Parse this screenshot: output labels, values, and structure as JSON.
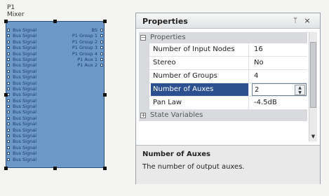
{
  "node": {
    "caption": "P1",
    "sub_caption": "Mixer",
    "inputs": [
      "Bus Signal",
      "Bus Signal",
      "Bus Signal",
      "Bus Signal",
      "Bus Signal",
      "Bus Signal",
      "Bus Signal",
      "Bus Signal",
      "Bus Signal",
      "Bus Signal",
      "Bus Signal",
      "Bus Signal",
      "Bus Signal",
      "Bus Signal",
      "Bus Signal",
      "Bus Signal",
      "Bus Signal",
      "Bus Signal",
      "Bus Signal",
      "Bus Signal",
      "Bus Signal",
      "Bus Signal",
      "Bus Signal"
    ],
    "outputs": [
      "BS",
      "P1 Group 1",
      "P1 Group 2",
      "P1 Group 3",
      "P1 Group 4",
      "P1 Aux 1",
      "P1 Aux 2"
    ]
  },
  "panel": {
    "title": "Properties",
    "pin_glyph": "ᛘ",
    "close_glyph": "×",
    "category_properties": "Properties",
    "category_state": "State Variables",
    "rows": [
      {
        "name": "Number of Input Nodes",
        "value": "16"
      },
      {
        "name": "Stereo",
        "value": "No"
      },
      {
        "name": "Number of Groups",
        "value": "4"
      },
      {
        "name": "Number of Auxes",
        "value": "2"
      },
      {
        "name": "Pan Law",
        "value": "-4.5dB"
      }
    ],
    "description_title": "Number of Auxes",
    "description_text": "The number of output auxes."
  }
}
